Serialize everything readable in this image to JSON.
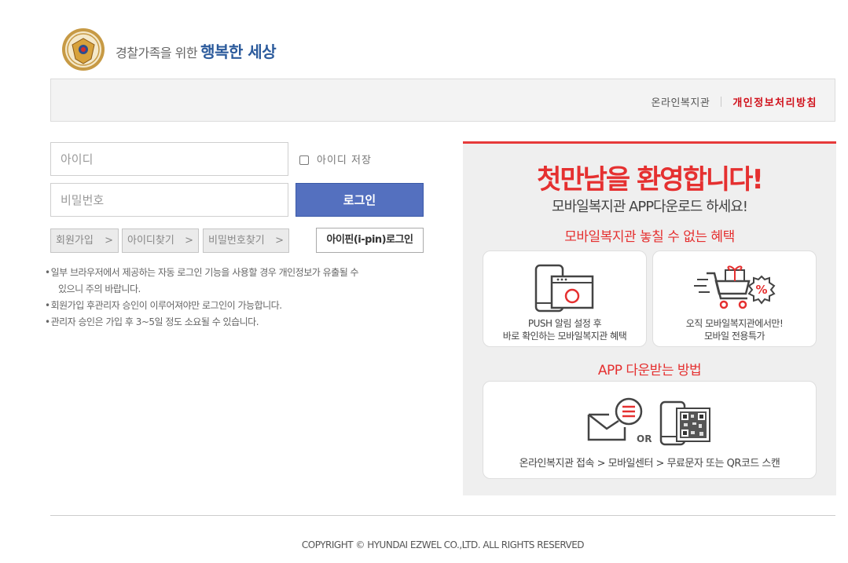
{
  "brand": {
    "tagline": "경찰가족을 위한",
    "tagline_strong": "행복한 세상"
  },
  "topbar": {
    "link_online": "온라인복지관",
    "link_privacy": "개인정보처리방침"
  },
  "login": {
    "id_placeholder": "아이디",
    "pw_placeholder": "비밀번호",
    "save_id_label": "아이디 저장",
    "save_id_checked": false,
    "login_button": "로그인",
    "join": "회원가입",
    "find_id": "아이디찾기",
    "find_pw": "비밀번호찾기",
    "ipin_login": "아이핀(i-pin)로그인"
  },
  "notes": [
    "일부 브라우저에서 제공하는 자동 로그인 기능을 사용할 경우 개인정보가 유출될 수",
    "있으니 주의 바랍니다.",
    "회원가입 후관리자 승인이 이루어져야만 로그인이 가능합니다.",
    "관리자 승인은 가입 후 3~5일 정도 소요될 수 있습니다."
  ],
  "promo": {
    "title": "첫만남을 환영합니다!",
    "subtitle": "모바일복지관 APP다운로드 하세요!",
    "benefit_heading": "모바일복지관 놓칠 수 없는 혜택",
    "card1_line1": "PUSH 알림 설정 후",
    "card1_line2": "바로 확인하는 모바일복지관 혜택",
    "card2_line1": "오직 모바일복지관에서만!",
    "card2_line2": "모바일 전용특가",
    "download_heading": "APP 다운받는 방법",
    "or_label": "OR",
    "download_steps": "온라인복지관 접속 > 모바일센터 > 무료문자 또는 QR코드 스캔",
    "accent_color": "#e53030"
  },
  "footer": {
    "copyright": "COPYRIGHT © HYUNDAI EZWEL CO.,LTD. ALL RIGHTS RESERVED"
  },
  "icons": {
    "logo": "police-emblem-icon",
    "checkbox": "checkbox-icon",
    "arrow": "chevron-right-icon",
    "push": "phone-browser-icon",
    "discount": "shopping-cart-discount-icon",
    "message": "envelope-message-icon",
    "qr": "phone-qr-icon"
  }
}
